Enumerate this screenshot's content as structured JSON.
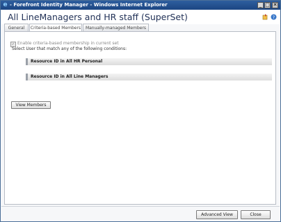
{
  "window": {
    "title": "- Forefront Identity Manager - Windows Internet Explorer",
    "controls": {
      "minimize": "_",
      "maximize": "□",
      "close": "✕"
    }
  },
  "header": {
    "title": "All LineManagers and HR staff (SuperSet)",
    "icons": [
      "add-to-list-icon",
      "help-icon"
    ]
  },
  "tabs": [
    {
      "label": "General",
      "active": false
    },
    {
      "label": "Criteria-based Members",
      "active": true
    },
    {
      "label": "Manually-managed Members",
      "active": false
    }
  ],
  "criteria": {
    "enable_label": "Enable criteria-based membership in current set",
    "instruction": "Select User that match any of the following conditions:",
    "conditions": [
      {
        "label": "Resource ID  in  All HR Personal"
      },
      {
        "label": "Resource ID  in  All Line Managers"
      }
    ]
  },
  "buttons": {
    "view_members": "View Members",
    "advanced_view": "Advanced View",
    "close": "Close"
  },
  "colors": {
    "titlebar": "#1c4683",
    "page_title": "#1f2f55"
  }
}
